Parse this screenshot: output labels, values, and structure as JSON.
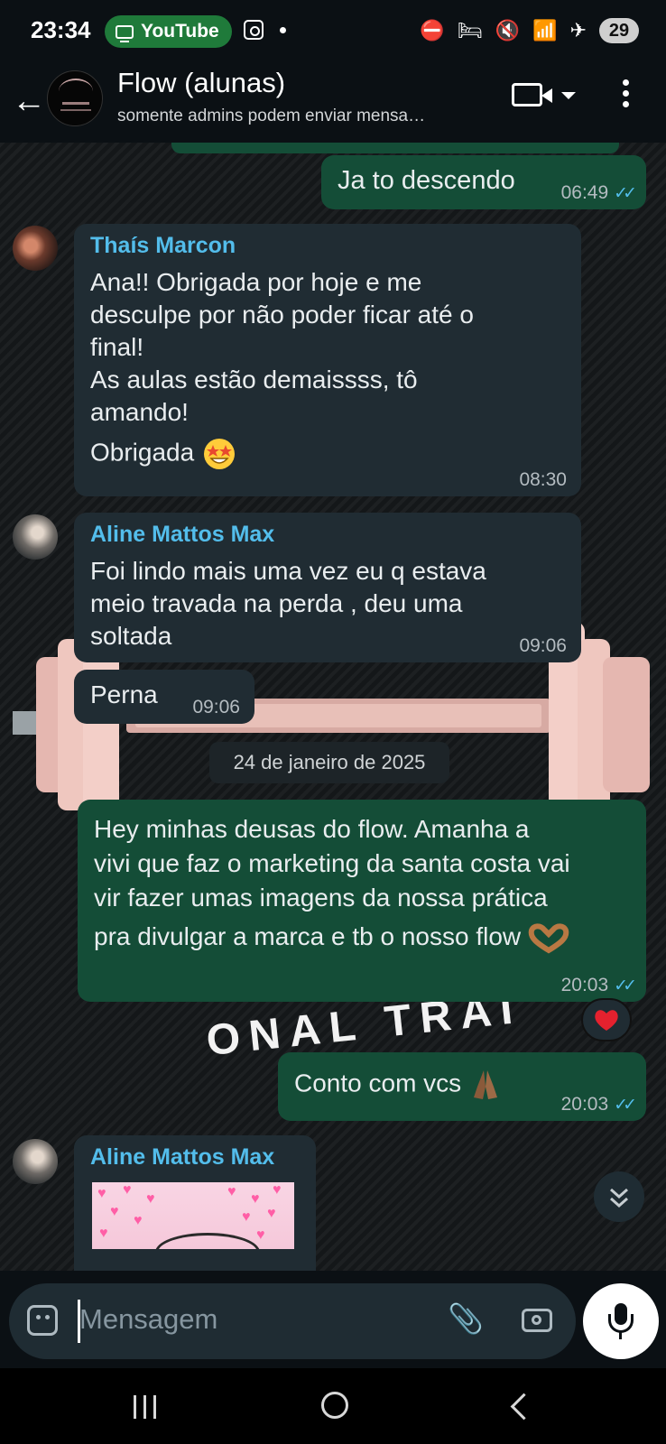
{
  "status_bar": {
    "time": "23:34",
    "app_pill": "YouTube",
    "battery": "29"
  },
  "header": {
    "title": "Flow (alunas)",
    "subtitle": "somente admins podem enviar mensa…"
  },
  "chat": {
    "messages": [
      {
        "direction": "out",
        "text": "Ja to descendo",
        "time": "06:49",
        "ticks": "✓✓"
      },
      {
        "direction": "in",
        "sender": "Thaís Marcon",
        "lines": [
          "Ana!! Obrigada por hoje e me",
          "desculpe por não poder ficar até o",
          "final!",
          "As aulas estão demaissss, tô",
          "amando!",
          "Obrigada"
        ],
        "emoji": "star-struck-emoji",
        "time": "08:30"
      },
      {
        "direction": "in",
        "sender": "Aline Mattos Max",
        "lines": [
          "Foi lindo mais uma vez eu q estava",
          "meio travada na perda , deu uma",
          "soltada"
        ],
        "time": "09:06"
      },
      {
        "direction": "in",
        "text": "Perna",
        "time": "09:06"
      },
      {
        "direction": "out",
        "lines": [
          "Hey minhas deusas do flow.   Amanha a",
          "vivi que faz o marketing da santa costa vai",
          "vir fazer umas imagens da nossa prática",
          "pra divulgar a marca e tb o nosso flow"
        ],
        "emoji": "heart-hands-emoji",
        "time": "20:03",
        "ticks": "✓✓",
        "reaction": "red-heart"
      },
      {
        "direction": "out",
        "text": "Conto com vcs",
        "emoji": "folded-hands-emoji",
        "time": "20:03",
        "ticks": "✓✓"
      },
      {
        "direction": "in",
        "sender": "Aline Mattos Max",
        "image": "hearts-image"
      }
    ],
    "date_divider": "24 de janeiro de 2025",
    "background_watermark": "ONAL TRAI"
  },
  "input": {
    "placeholder": "Mensagem"
  },
  "colors": {
    "incoming_bubble": "#202c33",
    "outgoing_bubble": "#144d37",
    "sender_name": "#53bdeb",
    "read_ticks": "#53bdeb"
  }
}
